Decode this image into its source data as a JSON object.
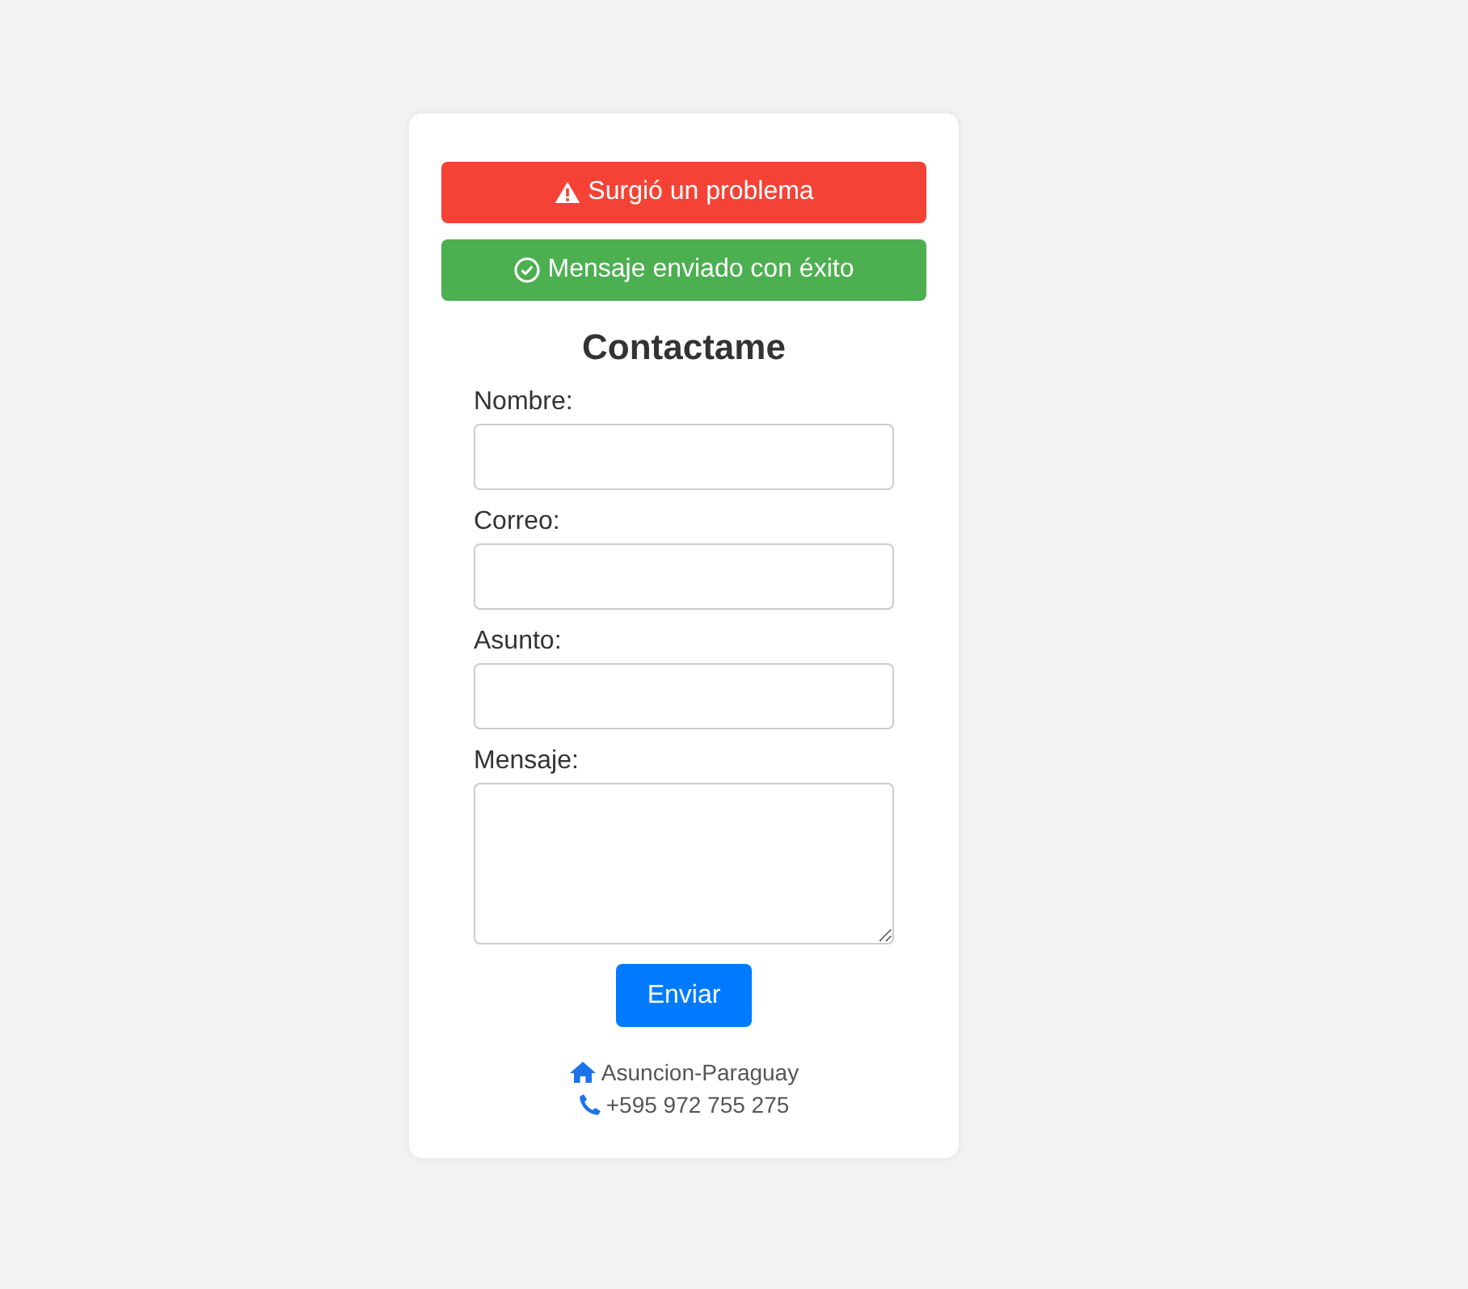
{
  "alerts": [
    {
      "kind": "error",
      "text": "Surgió un problema"
    },
    {
      "kind": "success",
      "text": "Mensaje enviado con éxito"
    }
  ],
  "title": "Contactame",
  "fields": [
    {
      "label": "Nombre:",
      "kind": "text"
    },
    {
      "label": "Correo:",
      "kind": "text"
    },
    {
      "label": "Asunto:",
      "kind": "text"
    },
    {
      "label": "Mensaje:",
      "kind": "textarea"
    }
  ],
  "submit": "Enviar",
  "contacts": [
    {
      "kind": "address",
      "text": "Asuncion-Paraguay"
    },
    {
      "kind": "phone",
      "text": "+595 972 755 275"
    }
  ]
}
